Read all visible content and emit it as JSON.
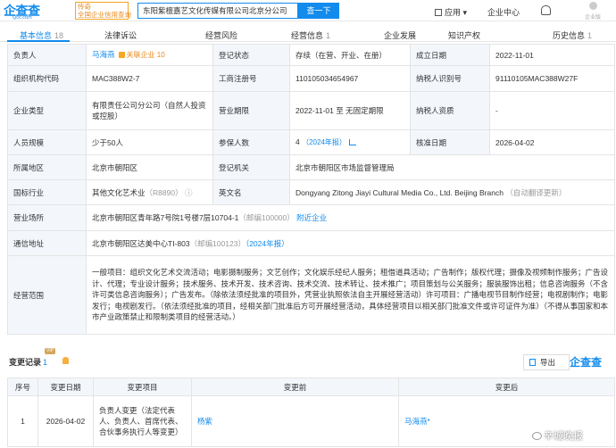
{
  "header": {
    "logo": "企查查",
    "logo_domain": "Qcc.com",
    "tag_line1": "传奇",
    "tag_line2": "全国企业信用查询",
    "search_value": "东阳紫檀嘉艺文化传媒有限公司北京分公司",
    "search_button": "查一下",
    "apps": "应用",
    "enterprise_center": "企业中心",
    "avatar_text": "企业版"
  },
  "tabs": [
    {
      "label": "基本信息",
      "count": "18"
    },
    {
      "label": "法律诉讼",
      "count": ""
    },
    {
      "label": "经营风险",
      "count": ""
    },
    {
      "label": "经营信息",
      "count": "1"
    },
    {
      "label": "企业发展",
      "count": ""
    },
    {
      "label": "知识产权",
      "count": ""
    },
    {
      "label": "历史信息",
      "count": "1"
    }
  ],
  "info": {
    "responsible_label": "负责人",
    "responsible": "马海燕",
    "related_tag": "关联企业",
    "related_count": "10",
    "reg_status_label": "登记状态",
    "reg_status": "存续（在营、开业、在册）",
    "est_date_label": "成立日期",
    "est_date": "2022-11-01",
    "org_code_label": "组织机构代码",
    "org_code": "MAC388W2-7",
    "biz_reg_label": "工商注册号",
    "biz_reg": "110105034654967",
    "taxpayer_id_label": "纳税人识别号",
    "taxpayer_id": "91110105MAC388W27F",
    "ent_type_label": "企业类型",
    "ent_type": "有限责任公司分公司（自然人投资或控股）",
    "biz_term_label": "营业期限",
    "biz_term": "2022-11-01 至 无固定期限",
    "taxpayer_qual_label": "纳税人资质",
    "taxpayer_qual": "-",
    "staff_label": "人员规模",
    "staff": "少于50人",
    "insured_label": "参保人数",
    "insured": "4",
    "insured_year": "（2024年报）",
    "approval_label": "核准日期",
    "approval": "2026-04-02",
    "region_label": "所属地区",
    "region": "北京市朝阳区",
    "authority_label": "登记机关",
    "authority": "北京市朝阳区市场监督管理局",
    "industry_label": "国标行业",
    "industry": "其他文化艺术业",
    "industry_code": "（R8890）",
    "en_name_label": "英文名",
    "en_name": "Dongyang Zitong Jiayi Cultural Media Co., Ltd. Beijing Branch",
    "auto_translate": "（自动翻译更新）",
    "biz_addr_label": "营业场所",
    "biz_addr": "北京市朝阳区青年路7号院1号楼7层10704-1",
    "biz_addr_zip": "（邮编100000）",
    "nearby": "附近企业",
    "mail_addr_label": "通信地址",
    "mail_addr": "北京市朝阳区达美中心TI-803",
    "mail_addr_zip": "（邮编100123）",
    "mail_addr_year": "（2024年报）",
    "scope_label": "经营范围",
    "scope_text": "一般项目：组织文化艺术交流活动；电影摄制服务；文艺创作；文化娱乐经纪人服务；租借道具活动；广告制作；版权代理；摄像及视频制作服务；广告设计、代理；专业设计服务；技术服务、技术开发、技术咨询、技术交流、技术转让、技术推广；项目策划与公关服务；服装服饰出租；信息咨询服务（不含许可类信息咨询服务）；广告发布。（除依法须经批准的项目外，凭营业执照依法自主开展经营活动）许可项目：广播电视节目制作经营；电视剧制作；电影发行；电视剧发行。（依法须经批准的项目，经相关部门批准后方可开展经营活动，具体经营项目以相关部门批准文件或许可证件为准）（不得从事国家和本市产业政策禁止和限制类项目的经营活动。）"
  },
  "changes": {
    "title": "变更记录",
    "count": "1",
    "vip": "VIP",
    "export": "导出",
    "watermark": "企查查",
    "headers": [
      "序号",
      "变更日期",
      "变更项目",
      "变更前",
      "变更后"
    ],
    "rows": [
      {
        "no": "1",
        "date": "2026-04-02",
        "item": "负责人变更（法定代表人、负责人、首席代表、合伙事务执行人等变更）",
        "before": "杨紫",
        "after": "马海燕*"
      }
    ]
  },
  "weibo_watermark": "辛城晚报"
}
